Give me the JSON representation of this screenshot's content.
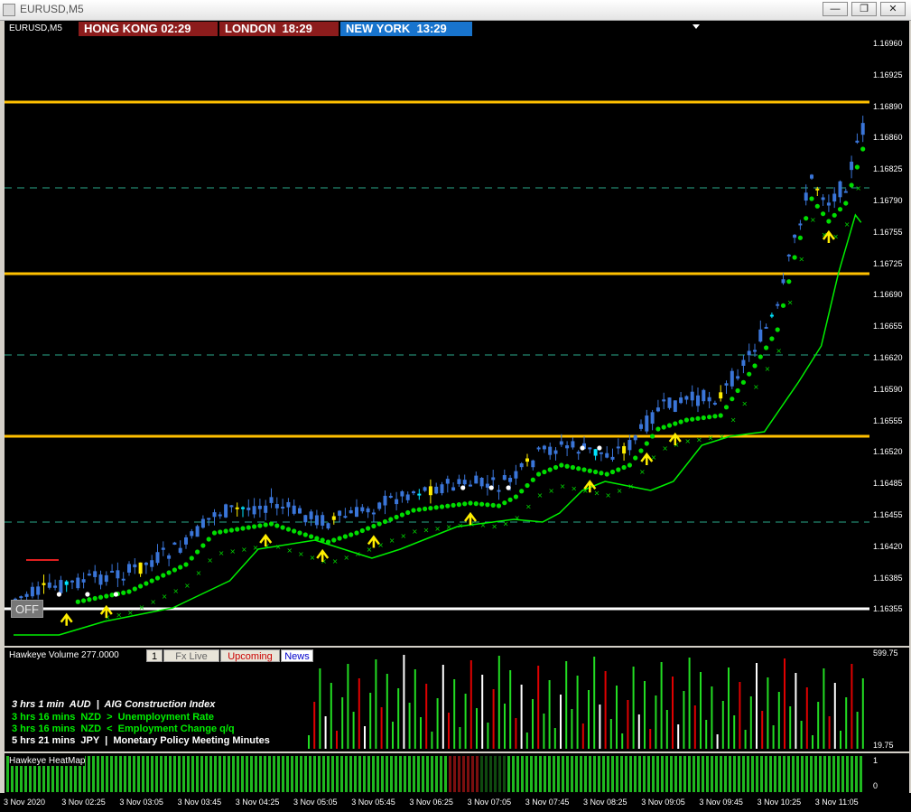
{
  "window": {
    "title": "EURUSD,M5"
  },
  "chart": {
    "symbol_label": "EURUSD,M5",
    "off_button": "OFF",
    "sessions": [
      {
        "label": "HONG KONG 02:29",
        "color": "#8c1c1c"
      },
      {
        "label": "LONDON  18:29",
        "color": "#8c1c1c"
      },
      {
        "label": "NEW YORK  13:29",
        "color": "#1874cd"
      }
    ],
    "price_levels": [
      "1.16960",
      "1.16925",
      "1.16890",
      "1.16860",
      "1.16825",
      "1.16790",
      "1.16755",
      "1.16725",
      "1.16690",
      "1.16655",
      "1.16620",
      "1.16590",
      "1.16555",
      "1.16520",
      "1.16485",
      "1.16455",
      "1.16420",
      "1.16385",
      "1.16355"
    ],
    "colors": {
      "bull": "#3a75d8",
      "bear": "#3a75d8",
      "highlight": "#ffee00",
      "cyan": "#00e5ff",
      "level": "#ffc000",
      "dots": "#00dd00",
      "trail": "#00ee00"
    }
  },
  "volume": {
    "name": "Hawkeye Volume 277.0000",
    "tabs": [
      {
        "label": "1",
        "text_color": "#000000",
        "bg": "#e8e4d8"
      },
      {
        "label": "Fx Live",
        "text_color": "#666666",
        "bg": "#e8e4d8"
      },
      {
        "label": "Upcoming",
        "text_color": "#cc0000",
        "bg": "#e8e4d8"
      },
      {
        "label": "News",
        "text_color": "#0000cc",
        "bg": "#ffffff"
      }
    ],
    "scale_top": "599.75",
    "scale_bottom": "19.75",
    "news_items": [
      {
        "text": "3 hrs 1 min  AUD  |  AIG Construction Index",
        "color": "#ffffff",
        "italic": true
      },
      {
        "text": "3 hrs 16 mins  NZD  >  Unemployment Rate",
        "color": "#00ee00",
        "italic": false
      },
      {
        "text": "3 hrs 16 mins  NZD  <  Employment Change q/q",
        "color": "#00ee00",
        "italic": false
      },
      {
        "text": "5 hrs 21 mins  JPY  |  Monetary Policy Meeting Minutes",
        "color": "#ffffff",
        "italic": false
      }
    ]
  },
  "heatmap": {
    "name": "Hawkeye HeatMap",
    "scale_top": "1",
    "scale_bottom": "0"
  },
  "time_axis": [
    "3 Nov 2020",
    "3 Nov 02:25",
    "3 Nov 03:05",
    "3 Nov 03:45",
    "3 Nov 04:25",
    "3 Nov 05:05",
    "3 Nov 05:45",
    "3 Nov 06:25",
    "3 Nov 07:05",
    "3 Nov 07:45",
    "3 Nov 08:25",
    "3 Nov 09:05",
    "3 Nov 09:45",
    "3 Nov 10:25",
    "3 Nov 11:05"
  ]
}
